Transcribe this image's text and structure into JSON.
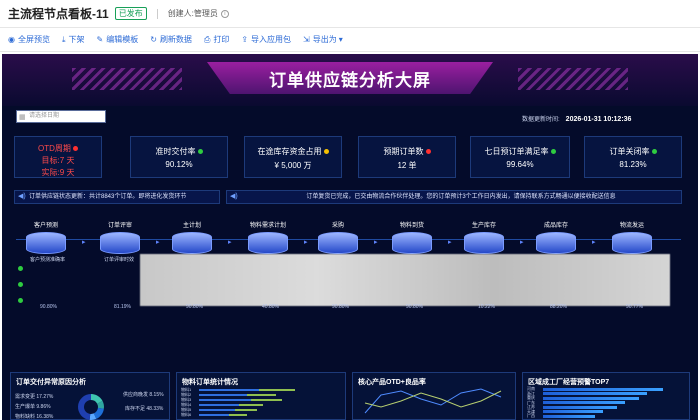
{
  "header": {
    "title": "主流程节点看板-11",
    "status": "已发布",
    "creator": "创建人:管理员"
  },
  "toolbar": [
    {
      "label": "全屏预览",
      "icon": "eye-icon"
    },
    {
      "label": "下架",
      "icon": "download-icon"
    },
    {
      "label": "编辑模板",
      "icon": "edit-icon"
    },
    {
      "label": "刷新数据",
      "icon": "refresh-icon"
    },
    {
      "label": "打印",
      "icon": "printer-icon"
    },
    {
      "label": "导入应用包",
      "icon": "import-icon"
    },
    {
      "label": "导出为",
      "icon": "export-icon"
    }
  ],
  "screen": {
    "title": "订单供应链分析大屏",
    "date_placeholder": "请选择日期",
    "update_label": "数据更新时间:",
    "update_time": "2026-01-31 10:12:36",
    "colors": {
      "bg": "#040b2a",
      "accent": "#9a1fa0",
      "ok": "#2ecc40",
      "bad": "#ff3030"
    }
  },
  "kpis": [
    {
      "title": "OTD周期",
      "line2": "目标:7 天",
      "line3": "实际:9 天",
      "status": "bad"
    },
    {
      "title": "准时交付率",
      "value": "90.12%",
      "status": "ok"
    },
    {
      "title": "在途库存资金占用",
      "value": "¥ 5,000 万",
      "status": "warn"
    },
    {
      "title": "预期订单数",
      "value": "12 单",
      "status": "bad"
    },
    {
      "title": "七日预订单满足率",
      "value": "99.64%",
      "status": "ok"
    },
    {
      "title": "订单关闭率",
      "value": "81.23%",
      "status": "ok"
    }
  ],
  "notices": [
    "订单供应链状态更新：共计8843个订单。即将进化发货环节",
    "订单复货已完成，已交由物流合作伙伴处理。您的订单预计3个工作日内发出，请保持联系方式畅通以便接收配送信息"
  ],
  "flow_steps": [
    "客户预测",
    "订单评审",
    "主计划",
    "物料需求计划",
    "采购",
    "物料到货",
    "生产库存",
    "成品库存",
    "物流发运"
  ],
  "flow_row_labels": [
    "客户预测准确率",
    "订单评审时效",
    "主计划达成率",
    "MRP运算准确",
    "采购订单下达及时率",
    "物料到货及时率",
    "生产库存周转率",
    "成品库存周转率",
    "物流发运及时率"
  ],
  "flow_percents": [
    "90.80%",
    "81.19%",
    "90.80%",
    "40.80%",
    "90.80%",
    "90.80%",
    "10.22%",
    "88.20%",
    "90.77%"
  ],
  "panels": {
    "donut": {
      "title": "订单交付异常原因分析",
      "labels": [
        "需求变更 17.27%",
        "生产爆单 9.86%",
        "物料缺料 16.38%",
        "供应商晚发 8.15%",
        "库存不足 48.33%"
      ],
      "values": [
        17.27,
        9.86,
        16.38,
        8.15,
        48.33
      ],
      "colors": [
        "#3fc5b0",
        "#2fa6a0",
        "#1e6fd8",
        "#5aa8ff",
        "#1f3fb0"
      ]
    },
    "bars": {
      "title": "物料订单统计情况",
      "categories": [
        "物料1",
        "物料2",
        "物料3",
        "物料4",
        "物料5",
        "物料6"
      ],
      "ticks": [
        "0",
        "5,000",
        "10,000",
        "15,000",
        "20,000"
      ],
      "legend": [
        "库存",
        "订单"
      ],
      "colors": [
        "#2f6fe0",
        "#8fbf50"
      ]
    },
    "line": {
      "title": "核心产品OTD+良品率",
      "x": [
        "1",
        "2",
        "3",
        "4",
        "5",
        "6",
        "7",
        "8"
      ],
      "y_ticks": [
        "0.6",
        "0.5",
        "0.4",
        "0.3",
        "0.2",
        "0.1",
        "0.0"
      ]
    },
    "top7": {
      "title": "区域成工厂经营预警TOP7",
      "regions": [
        "河南",
        "浙江",
        "重庆",
        "广东",
        "江苏",
        "天津",
        "广西"
      ],
      "ticks": [
        "0",
        "8",
        "16",
        "24",
        "32"
      ]
    }
  }
}
